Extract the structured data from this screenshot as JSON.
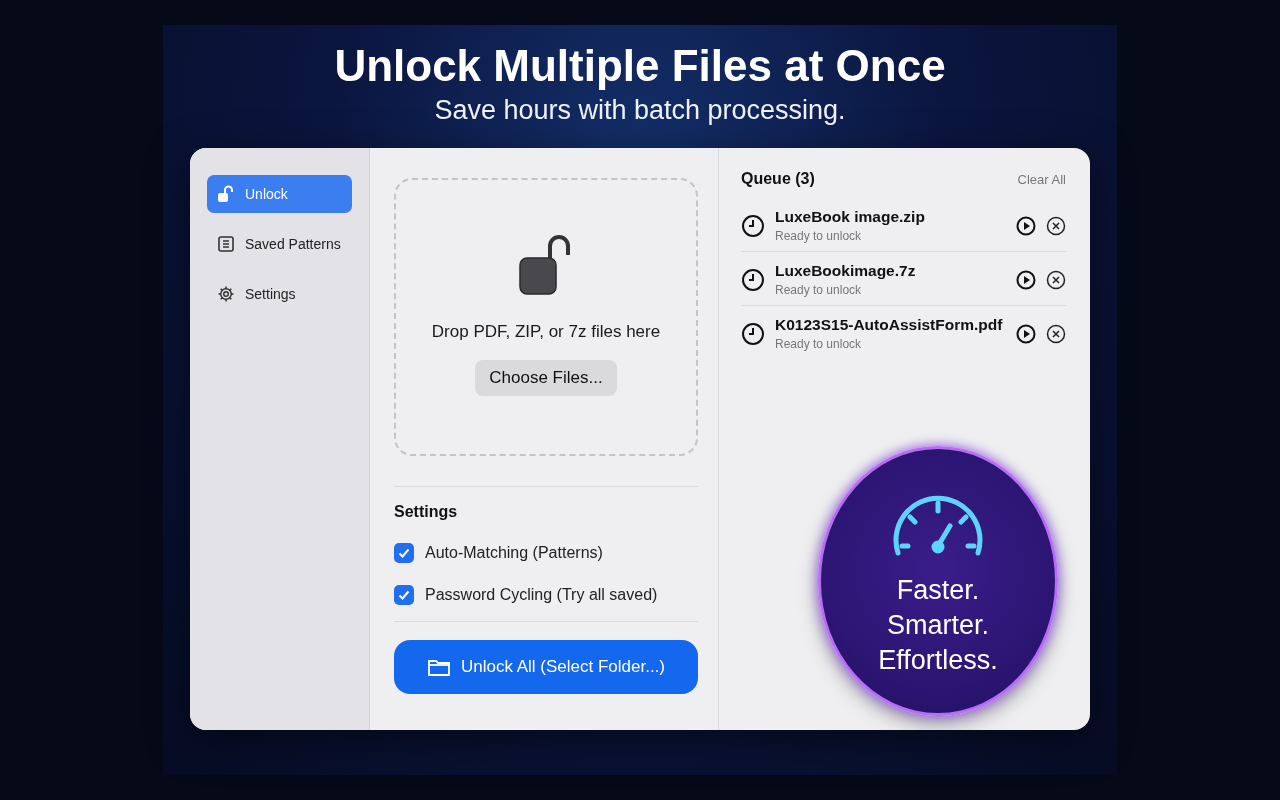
{
  "headline": "Unlock Multiple Files at Once",
  "subheadline": "Save hours with batch processing.",
  "sidebar": {
    "items": [
      {
        "label": "Unlock",
        "kind": "unlock",
        "selected": true
      },
      {
        "label": "Saved Patterns",
        "kind": "list",
        "selected": false
      },
      {
        "label": "Settings",
        "kind": "gear",
        "selected": false
      }
    ]
  },
  "dropzone": {
    "text": "Drop PDF, ZIP, or 7z files here",
    "button": "Choose Files..."
  },
  "settings": {
    "title": "Settings",
    "options": [
      {
        "label": "Auto-Matching (Patterns)",
        "checked": true
      },
      {
        "label": "Password Cycling (Try all saved)",
        "checked": true
      }
    ]
  },
  "primary_button": "Unlock All (Select Folder...)",
  "queue": {
    "title": "Queue (3)",
    "clear": "Clear All",
    "items": [
      {
        "name": "LuxeBook image.zip",
        "status": "Ready to unlock"
      },
      {
        "name": "LuxeBookimage.7z",
        "status": "Ready to unlock"
      },
      {
        "name": "K0123S15-AutoAssistForm.pdf",
        "status": "Ready to unlock"
      }
    ]
  },
  "badge": {
    "lines": [
      "Faster.",
      "Smarter.",
      "Effortless."
    ]
  }
}
